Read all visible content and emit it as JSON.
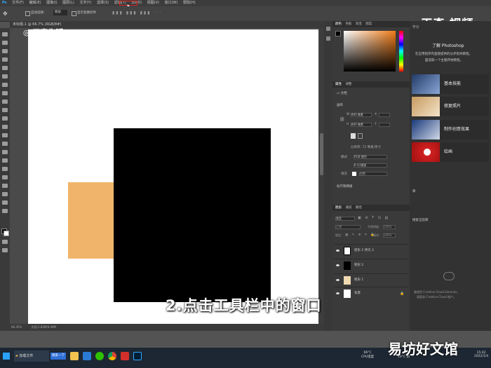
{
  "menubar": {
    "items": [
      "文件(F)",
      "编辑(E)",
      "图像(I)",
      "图层(L)",
      "文字(Y)",
      "选择(S)",
      "滤镜(T)",
      "3D(D)",
      "视图(V)",
      "窗口(W)",
      "帮助(H)"
    ]
  },
  "options": {
    "auto_select": "自动选择：",
    "layer_select": "图层",
    "transform": "显示变换控件"
  },
  "document": {
    "tab": "未标题-1 @ 66.7% (RGB/8#)",
    "zoom": "66.35%",
    "doc_info": "文档:1.83M/0.49M"
  },
  "branding": {
    "logo": "天奇生活",
    "logo_right": "天奇·视频",
    "caption": "2.点击工具栏中的窗口",
    "watermark": "易坊好文馆"
  },
  "panels": {
    "color_tabs": [
      "颜色",
      "色板",
      "渐变",
      "图案"
    ],
    "props_tabs": [
      "属性",
      "调整"
    ],
    "doc_label": "文档",
    "canvas_label": "画布",
    "w_label": "W",
    "w_value": "800 像素",
    "h_label": "H",
    "h_value": "800 像素",
    "x_label": "X",
    "y_label": "Y",
    "resolution": "分辨率: 72 像素/英寸",
    "mode_label": "模式",
    "mode_value": "RGB 颜色",
    "bits_value": "8 位/通道",
    "bg_label": "填充",
    "bg_value": "白色",
    "rulers_label": "标尺和网格",
    "layers_tabs": [
      "图层",
      "通道",
      "路径"
    ],
    "layer_kind": "类型",
    "blend_mode": "正常",
    "opacity_label": "不透明度:",
    "opacity": "100%",
    "lock_label": "锁定:",
    "fill_label": "填充:",
    "fill": "100%",
    "layers": [
      "矩形 2 拷贝 2",
      "矩形 2",
      "矩形 1",
      "背景"
    ]
  },
  "learn": {
    "tab": "学习",
    "title": "了解 Photoshop",
    "desc": "在应用程序内直接提供的分步指导教程。",
    "desc2": "面选取一个主题开始教程。",
    "items": [
      "基本技能",
      "修复照片",
      "制作创意效果",
      "绘画"
    ],
    "lib_tab": "库",
    "lib_hint": "搜索当前库",
    "cc_text": "要使用 Creative Cloud Libraries，",
    "cc_text2": "请登录 Creative Cloud 账户。"
  },
  "taskbar": {
    "search": "在这里输入你要搜索的内容",
    "folder": "加载文件",
    "search_btn": "搜索一下",
    "weather": "19°C 阴",
    "cpu_temp": "66°C",
    "cpu_label": "CPU温度",
    "time": "15:42",
    "date": "2022/1/4"
  },
  "colors": {
    "accent_highlight": "#e02020",
    "orange_rect": "#f0b56a"
  }
}
